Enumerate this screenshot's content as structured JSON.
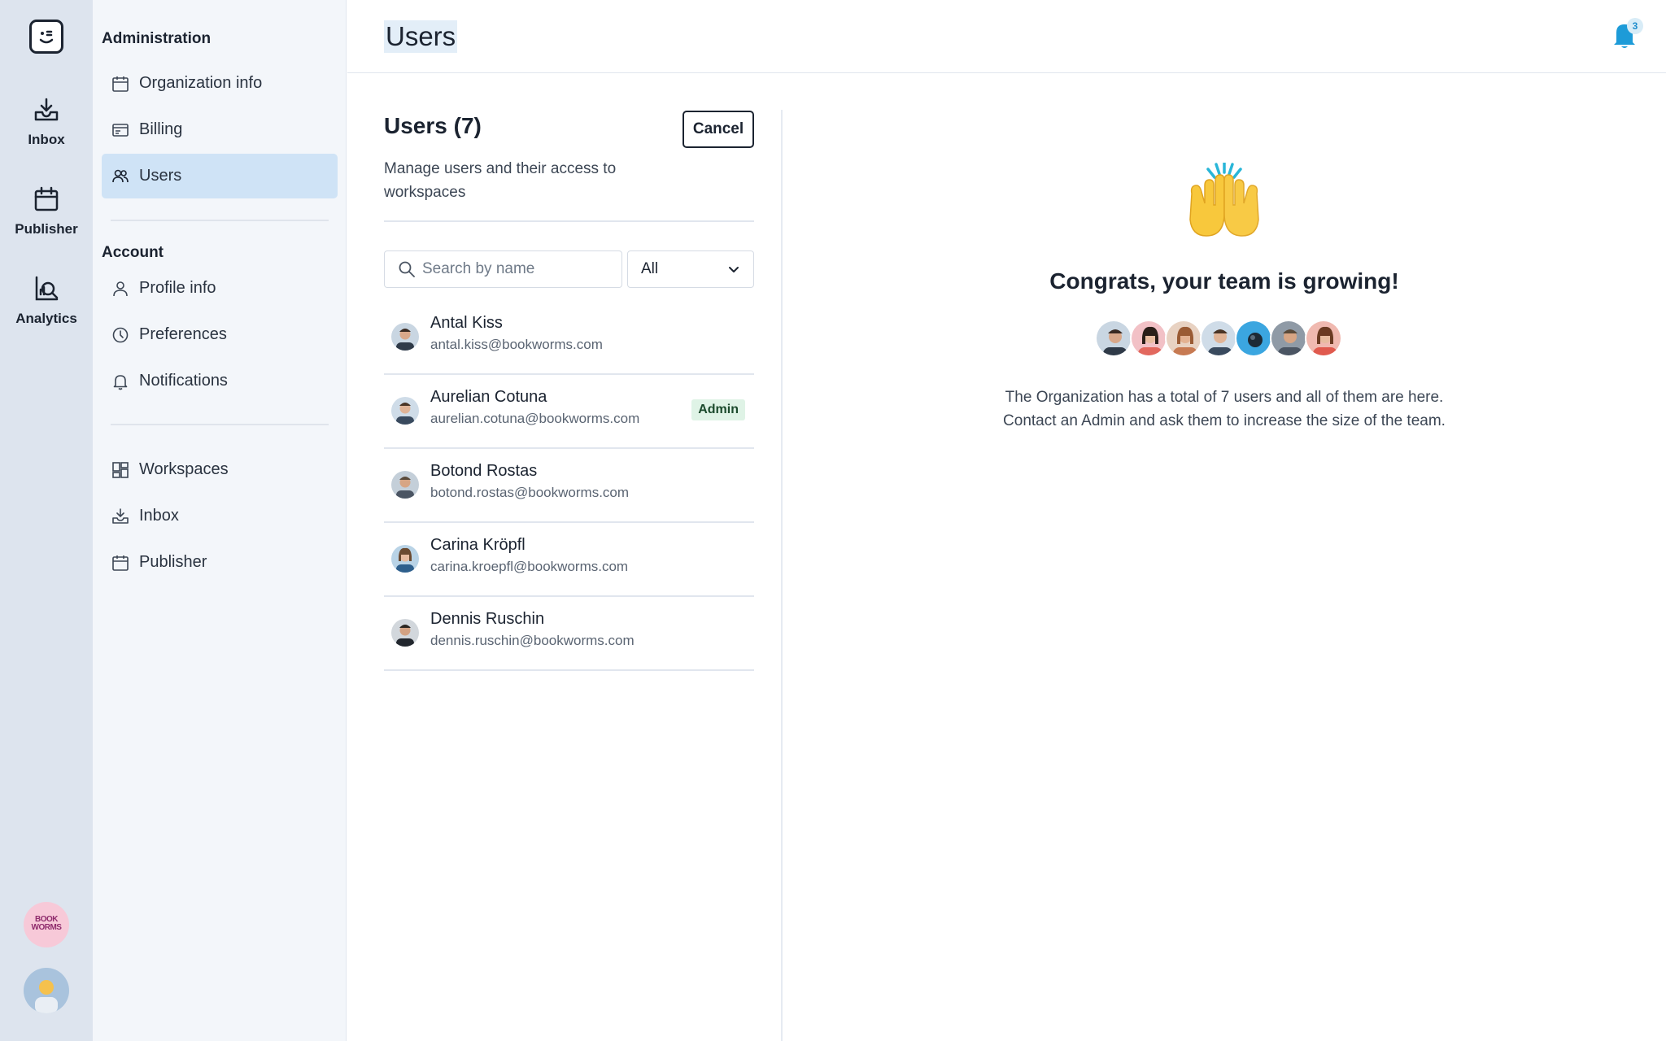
{
  "header": {
    "title": "Users",
    "notification_count": "3"
  },
  "rail": {
    "items": [
      {
        "label": "Inbox",
        "icon": "inbox-icon"
      },
      {
        "label": "Publisher",
        "icon": "calendar-icon"
      },
      {
        "label": "Analytics",
        "icon": "analytics-icon"
      }
    ],
    "org_logo_text": "BOOK WORMS"
  },
  "sidebar": {
    "admin_heading": "Administration",
    "admin_items": [
      {
        "label": "Organization info",
        "icon": "calendar-icon"
      },
      {
        "label": "Billing",
        "icon": "billing-icon"
      },
      {
        "label": "Users",
        "icon": "users-icon",
        "active": true
      }
    ],
    "account_heading": "Account",
    "account_items": [
      {
        "label": "Profile info",
        "icon": "person-icon"
      },
      {
        "label": "Preferences",
        "icon": "clock-icon"
      },
      {
        "label": "Notifications",
        "icon": "bell-icon"
      }
    ],
    "other_items": [
      {
        "label": "Workspaces",
        "icon": "grid-icon"
      },
      {
        "label": "Inbox",
        "icon": "inbox-icon"
      },
      {
        "label": "Publisher",
        "icon": "calendar-icon"
      }
    ]
  },
  "users_panel": {
    "title": "Users (7)",
    "cancel_label": "Cancel",
    "description": "Manage users and their access to workspaces",
    "search_placeholder": "Search by name",
    "filter_value": "All",
    "users": [
      {
        "name": "Antal Kiss",
        "email": "antal.kiss@bookworms.com",
        "badge": ""
      },
      {
        "name": "Aurelian Cotuna",
        "email": "aurelian.cotuna@bookworms.com",
        "badge": "Admin"
      },
      {
        "name": "Botond Rostas",
        "email": "botond.rostas@bookworms.com",
        "badge": ""
      },
      {
        "name": "Carina Kröpfl",
        "email": "carina.kroepfl@bookworms.com",
        "badge": ""
      },
      {
        "name": "Dennis Ruschin",
        "email": "dennis.ruschin@bookworms.com",
        "badge": ""
      }
    ]
  },
  "congrats": {
    "title": "Congrats, your team is growing!",
    "line1": "The Organization has a total of 7 users and all of them are here.",
    "line2": "Contact an Admin and ask them to increase the size of the team.",
    "avatar_count": 7
  },
  "colors": {
    "rail_bg": "#dde4ee",
    "sidebar_bg": "#f3f6fa",
    "active_item": "#cfe3f6",
    "bell": "#1d9bd8",
    "admin_badge_bg": "#dff3e6"
  }
}
